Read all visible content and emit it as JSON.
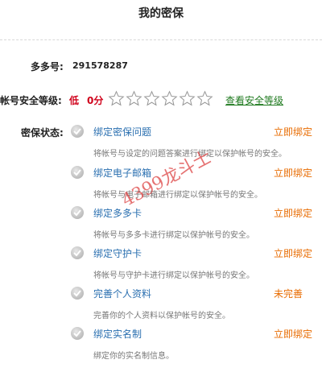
{
  "header": {
    "title": "我的密保"
  },
  "account": {
    "label": "多多号:",
    "value": "291578287"
  },
  "security": {
    "label": "帐号安全等级:",
    "level": "低",
    "score": "0分",
    "stars_filled": 0,
    "stars_total": 6,
    "link": "查看安全等级"
  },
  "status_label": "密保状态:",
  "items": [
    {
      "title": "绑定密保问题",
      "action": "立即绑定",
      "desc": "将帐号与设定的问题答案进行绑定以保护帐号的安全。"
    },
    {
      "title": "绑定电子邮箱",
      "action": "立即绑定",
      "desc": "将帐号与电子邮箱进行绑定以保护帐号的安全。"
    },
    {
      "title": "绑定多多卡",
      "action": "立即绑定",
      "desc": "将帐号与多多卡进行绑定以保护帐号的安全。"
    },
    {
      "title": "绑定守护卡",
      "action": "立即绑定",
      "desc": "将帐号与守护卡进行绑定以保护帐号的安全。"
    },
    {
      "title": "完善个人资料",
      "action": "未完善",
      "desc": "完善你的个人资料以保护帐号的安全。"
    },
    {
      "title": "绑定实名制",
      "action": "立即绑定",
      "desc": "绑定你的实名制信息。"
    }
  ],
  "watermark": "4399龙斗士",
  "colors": {
    "link_blue": "#2a6fb0",
    "action_orange": "#e86b00",
    "level_red": "#d0021b",
    "link_green": "#1f7a1f"
  }
}
